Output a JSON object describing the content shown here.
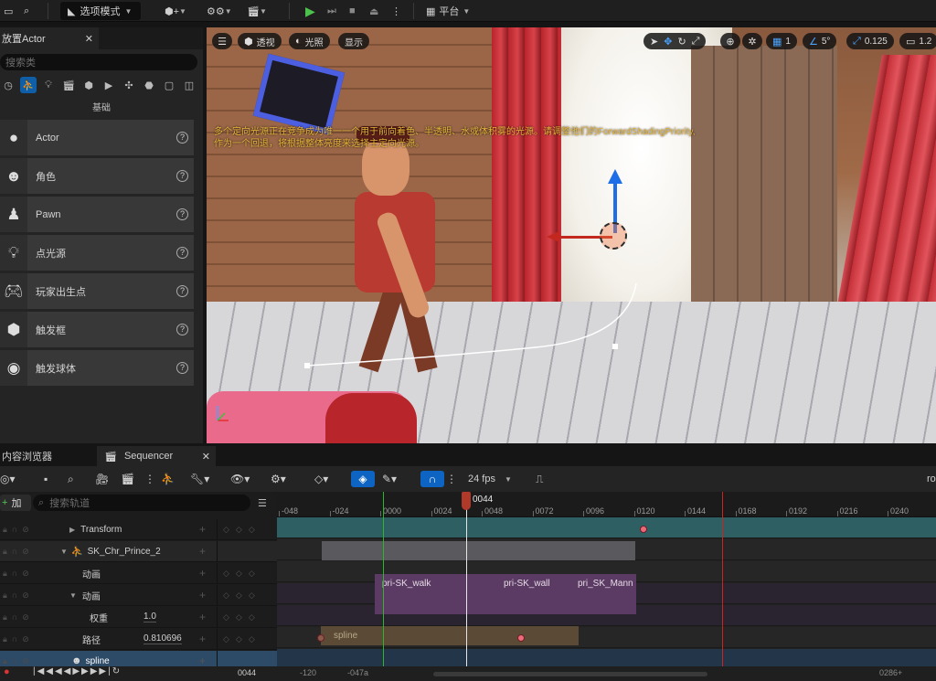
{
  "toolbar": {
    "mode_label": "选项模式",
    "platform_label": "平台"
  },
  "place_actor": {
    "tab_title": "放置Actor",
    "search_placeholder": "搜索类",
    "category_label": "基础",
    "items": [
      {
        "name": "Actor",
        "icon": "sphere-icon"
      },
      {
        "name": "角色",
        "icon": "character-icon"
      },
      {
        "name": "Pawn",
        "icon": "pawn-icon"
      },
      {
        "name": "点光源",
        "icon": "point-light-icon"
      },
      {
        "name": "玩家出生点",
        "icon": "player-start-icon"
      },
      {
        "name": "触发框",
        "icon": "trigger-box-icon"
      },
      {
        "name": "触发球体",
        "icon": "trigger-sphere-icon"
      }
    ]
  },
  "viewport": {
    "perspective_label": "透视",
    "lighting_label": "光照",
    "show_label": "显示",
    "grid_value": "1",
    "angle_value": "5°",
    "scale_value": "0.125",
    "camera_speed_value": "1.2",
    "warning_line1": "多个定向光源正在竞争成为唯一一个用于前向着色、半透明、水或体积雾的光源。请调整他们的ForwardShadingPriority,",
    "warning_line2": "作为一个回退，将根据整体亮度来选择主定向光源。"
  },
  "bottom": {
    "content_browser_tab": "内容浏览器",
    "sequencer_tab": "Sequencer",
    "fps_label": "24 fps",
    "right_cut_label": "ro",
    "add_label": "加",
    "track_search_placeholder": "搜索轨道",
    "current_frame": "0044",
    "frame_field": "0044",
    "ruler_labels": [
      "-048",
      "-024",
      "0000",
      "0024",
      "0048",
      "0072",
      "0096",
      "0120",
      "0144",
      "0168",
      "0192",
      "0216",
      "0240",
      "026"
    ],
    "tracks": [
      {
        "name": "Transform",
        "value": ""
      },
      {
        "name": "SK_Chr_Prince_2",
        "value": ""
      },
      {
        "name": "动画",
        "value": ""
      },
      {
        "name": "动画",
        "value": ""
      },
      {
        "name": "权重",
        "value": "1.0"
      },
      {
        "name": "路径",
        "value": "0.810696"
      },
      {
        "name": "spline",
        "value": ""
      }
    ],
    "sections": {
      "anim1": "pri-SK_walk",
      "anim2": "pri-SK_wall",
      "anim3": "pri_SK_Mann",
      "spline": "spline"
    },
    "strip_left": "-120",
    "strip_mid": "-047a",
    "strip_right": "0286+"
  },
  "colors": {
    "accent_blue": "#0e64c2",
    "range_start": "#28b828",
    "range_end": "#d0231d",
    "playhead": "#b0392a"
  }
}
